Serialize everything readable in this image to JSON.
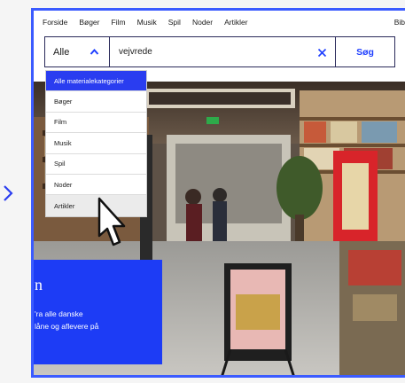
{
  "nav": {
    "items": [
      "Forside",
      "Bøger",
      "Film",
      "Musik",
      "Spil",
      "Noder",
      "Artikler"
    ],
    "right_link": "Bib"
  },
  "search": {
    "category_selected": "Alle",
    "query": "vejvrede",
    "button_label": "Søg"
  },
  "dropdown": {
    "options": [
      "Alle materialekategorier",
      "Bøger",
      "Film",
      "Musik",
      "Spil",
      "Noder",
      "Artikler"
    ],
    "active_index": 0,
    "hover_index": 6
  },
  "promo": {
    "title": "n",
    "line1": "'ra alle danske",
    "line2": "låne og aflevere på"
  },
  "colors": {
    "accent_blue": "#1d3cf5",
    "frame_blue": "#3b5bff",
    "button_text": "#1f3fff",
    "border_dark": "#2a2a5a"
  },
  "icons": {
    "left_chevron": "chevron-right-icon",
    "caret": "chevron-up-icon",
    "clear": "close-icon",
    "cursor": "pointer-hand-icon"
  }
}
